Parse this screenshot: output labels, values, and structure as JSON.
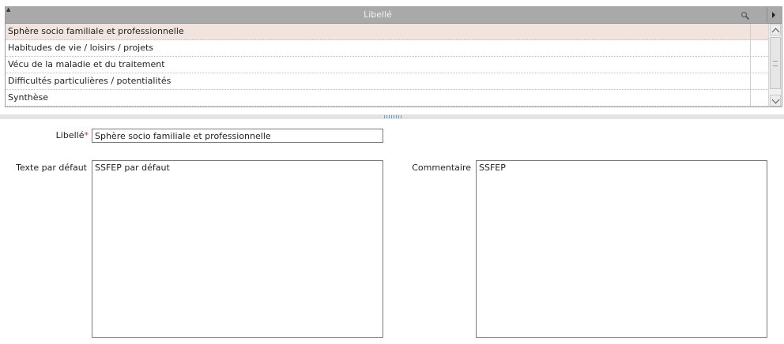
{
  "grid": {
    "column_header": "Libellé",
    "rows": [
      {
        "label": "Sphère socio familiale et professionnelle",
        "selected": true
      },
      {
        "label": "Habitudes de vie / loisirs / projets"
      },
      {
        "label": "Vécu de la maladie et du traitement"
      },
      {
        "label": "Difficultés particulières / potentialités"
      },
      {
        "label": "Synthèse"
      }
    ]
  },
  "form": {
    "libelle_label": "Libellé",
    "required_mark": "*",
    "libelle_value": "Sphère socio familiale et professionnelle",
    "texte_label": "Texte par défaut",
    "texte_value": "SSFEP par défaut",
    "commentaire_label": "Commentaire",
    "commentaire_value": "SSFEP"
  },
  "colors": {
    "header_bg": "#a9a9a9",
    "selected_row": "#f1e4df",
    "required": "#c0392b",
    "splitter_handle": "#5aa9c6"
  }
}
